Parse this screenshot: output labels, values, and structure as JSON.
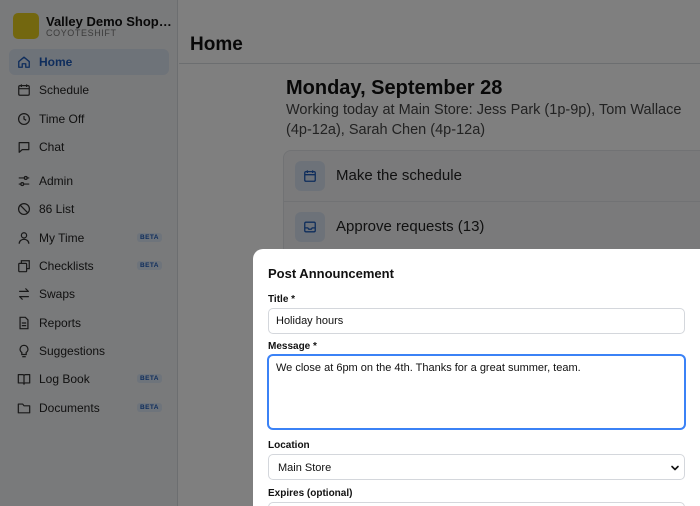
{
  "brand": {
    "name": "Valley Demo Shop - ...",
    "sub": "COYOTESHIFT"
  },
  "nav": [
    {
      "label": "Home",
      "icon": "home-icon",
      "active": true
    },
    {
      "label": "Schedule",
      "icon": "calendar-icon"
    },
    {
      "label": "Time Off",
      "icon": "clock-icon"
    },
    {
      "label": "Chat",
      "icon": "chat-icon"
    },
    {
      "label": "Admin",
      "icon": "sliders-icon"
    },
    {
      "label": "86 List",
      "icon": "prohibited-icon"
    },
    {
      "label": "My Time",
      "icon": "person-icon",
      "badge": "BETA"
    },
    {
      "label": "Checklists",
      "icon": "copy-icon",
      "badge": "BETA"
    },
    {
      "label": "Swaps",
      "icon": "swap-icon"
    },
    {
      "label": "Reports",
      "icon": "document-icon"
    },
    {
      "label": "Suggestions",
      "icon": "lightbulb-icon"
    },
    {
      "label": "Log Book",
      "icon": "book-icon",
      "badge": "BETA"
    },
    {
      "label": "Documents",
      "icon": "folder-icon",
      "badge": "BETA"
    }
  ],
  "header": {
    "title": "Home"
  },
  "day": {
    "title": "Monday, September 28",
    "working": "Working today at Main Store: Jess Park (1p-9p), Tom Wallace (4p-12a), Sarah Chen (4p-12a)"
  },
  "actions": [
    {
      "label": "Make the schedule",
      "icon": "calendar-icon"
    },
    {
      "label": "Approve requests (13)",
      "icon": "inbox-icon"
    }
  ],
  "modal": {
    "title": "Post Announcement",
    "title_label": "Title *",
    "title_value": "Holiday hours",
    "message_label": "Message *",
    "message_value": "We close at 6pm on the 4th. Thanks for a great summer, team.",
    "location_label": "Location",
    "location_value": "Main Store",
    "expires_label": "Expires (optional)"
  },
  "colors": {
    "accent": "#1e5bb8",
    "brand": "#e6cf1f",
    "focus": "#3b82f6"
  }
}
